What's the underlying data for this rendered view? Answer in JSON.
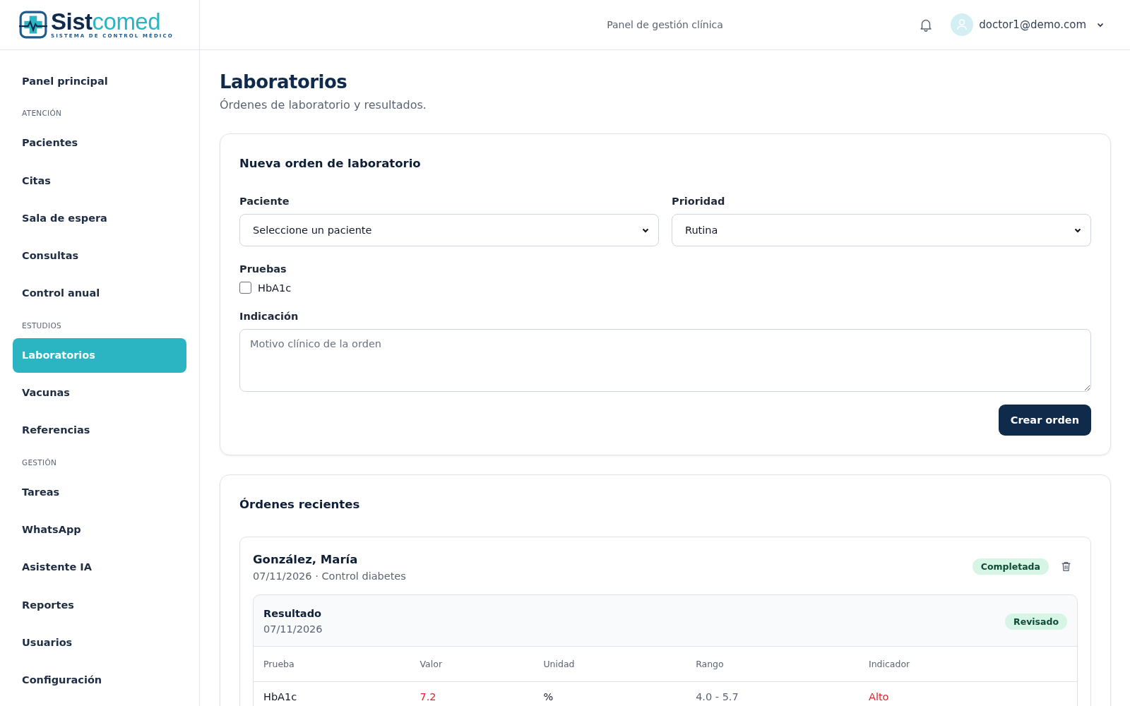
{
  "logo": {
    "name_start": "Sist",
    "name_end": "comed",
    "tagline": "SISTEMA DE CONTROL MÉDICO"
  },
  "header": {
    "title": "Panel de gestión clínica",
    "user": "doctor1@demo.com"
  },
  "sidebar": {
    "items": [
      {
        "kind": "item",
        "label": "Panel principal",
        "selected": false
      },
      {
        "kind": "section",
        "label": "ATENCIÓN"
      },
      {
        "kind": "item",
        "label": "Pacientes",
        "selected": false
      },
      {
        "kind": "item",
        "label": "Citas",
        "selected": false
      },
      {
        "kind": "item",
        "label": "Sala de espera",
        "selected": false
      },
      {
        "kind": "item",
        "label": "Consultas",
        "selected": false
      },
      {
        "kind": "item",
        "label": "Control anual",
        "selected": false
      },
      {
        "kind": "section",
        "label": "ESTUDIOS"
      },
      {
        "kind": "item",
        "label": "Laboratorios",
        "selected": true
      },
      {
        "kind": "item",
        "label": "Vacunas",
        "selected": false
      },
      {
        "kind": "item",
        "label": "Referencias",
        "selected": false
      },
      {
        "kind": "section",
        "label": "GESTIÓN"
      },
      {
        "kind": "item",
        "label": "Tareas",
        "selected": false
      },
      {
        "kind": "item",
        "label": "WhatsApp",
        "selected": false
      },
      {
        "kind": "item",
        "label": "Asistente IA",
        "selected": false
      },
      {
        "kind": "item",
        "label": "Reportes",
        "selected": false
      },
      {
        "kind": "item",
        "label": "Usuarios",
        "selected": false
      },
      {
        "kind": "item",
        "label": "Configuración",
        "selected": false
      }
    ]
  },
  "page": {
    "title": "Laboratorios",
    "subtitle": "Órdenes de laboratorio y resultados."
  },
  "new_order": {
    "title": "Nueva orden de laboratorio",
    "patient": {
      "label": "Paciente",
      "value": "Seleccione un paciente"
    },
    "priority": {
      "label": "Prioridad",
      "value": "Rutina"
    },
    "tests": {
      "label": "Pruebas",
      "options": [
        {
          "label": "HbA1c",
          "checked": false
        }
      ]
    },
    "indication": {
      "label": "Indicación",
      "placeholder": "Motivo clínico de la orden"
    },
    "submit": "Crear orden"
  },
  "recent": {
    "title": "Órdenes recientes",
    "orders": [
      {
        "patient": "González, María",
        "meta": "07/11/2026 · Control diabetes",
        "status": "Completada",
        "result": {
          "title": "Resultado",
          "date": "07/11/2026",
          "status": "Revisado",
          "columns": [
            "Prueba",
            "Valor",
            "Unidad",
            "Rango",
            "Indicador"
          ],
          "rows": [
            {
              "test": "HbA1c",
              "value": "7.2",
              "unit": "%",
              "range": "4.0 - 5.7",
              "flag": "Alto",
              "abnormal": true
            }
          ]
        }
      }
    ]
  }
}
